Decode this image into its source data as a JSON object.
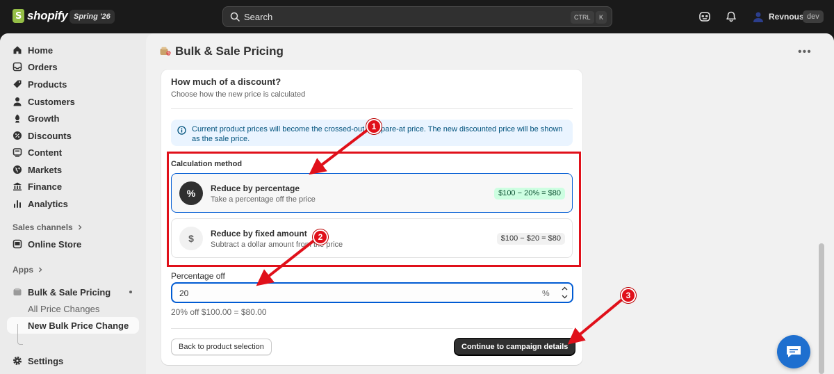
{
  "topbar": {
    "brand": "shopify",
    "version": "Spring '26",
    "search_placeholder": "Search",
    "shortcut_ctrl": "CTRL",
    "shortcut_k": "K",
    "user_name": "Revnous",
    "user_badge": "dev"
  },
  "sidebar": {
    "items": [
      {
        "label": "Home",
        "icon": "home-icon"
      },
      {
        "label": "Orders",
        "icon": "orders-icon"
      },
      {
        "label": "Products",
        "icon": "tag-icon"
      },
      {
        "label": "Customers",
        "icon": "person-icon"
      },
      {
        "label": "Growth",
        "icon": "growth-icon"
      },
      {
        "label": "Discounts",
        "icon": "discount-icon"
      },
      {
        "label": "Content",
        "icon": "content-icon"
      },
      {
        "label": "Markets",
        "icon": "globe-icon"
      },
      {
        "label": "Finance",
        "icon": "bank-icon"
      },
      {
        "label": "Analytics",
        "icon": "chart-icon"
      }
    ],
    "sales_channels_label": "Sales channels",
    "online_store_label": "Online Store",
    "apps_label": "Apps",
    "app_name": "Bulk & Sale Pricing",
    "sub_items": [
      "All Price Changes",
      "New Bulk Price Change"
    ],
    "settings_label": "Settings"
  },
  "page": {
    "title": "Bulk & Sale Pricing"
  },
  "card": {
    "title": "How much of a discount?",
    "subtitle": "Choose how the new price is calculated",
    "banner": "Current product prices will become the crossed-out compare-at price. The new discounted price will be shown as the sale price.",
    "calc_label": "Calculation method",
    "options": [
      {
        "title": "Reduce by percentage",
        "desc": "Take a percentage off the price",
        "example": "$100 − 20% = $80",
        "symbol": "%",
        "selected": true
      },
      {
        "title": "Reduce by fixed amount",
        "desc": "Subtract a dollar amount from the price",
        "example": "$100 − $20 = $80",
        "symbol": "$",
        "selected": false
      }
    ],
    "field_label": "Percentage off",
    "field_value": "20",
    "field_suffix": "%",
    "help_text": "20% off $100.00 = $80.00",
    "back_button": "Back to product selection",
    "continue_button": "Continue to campaign details"
  },
  "annotations": {
    "markers": [
      "1",
      "2",
      "3"
    ],
    "color": "#e0101a"
  }
}
